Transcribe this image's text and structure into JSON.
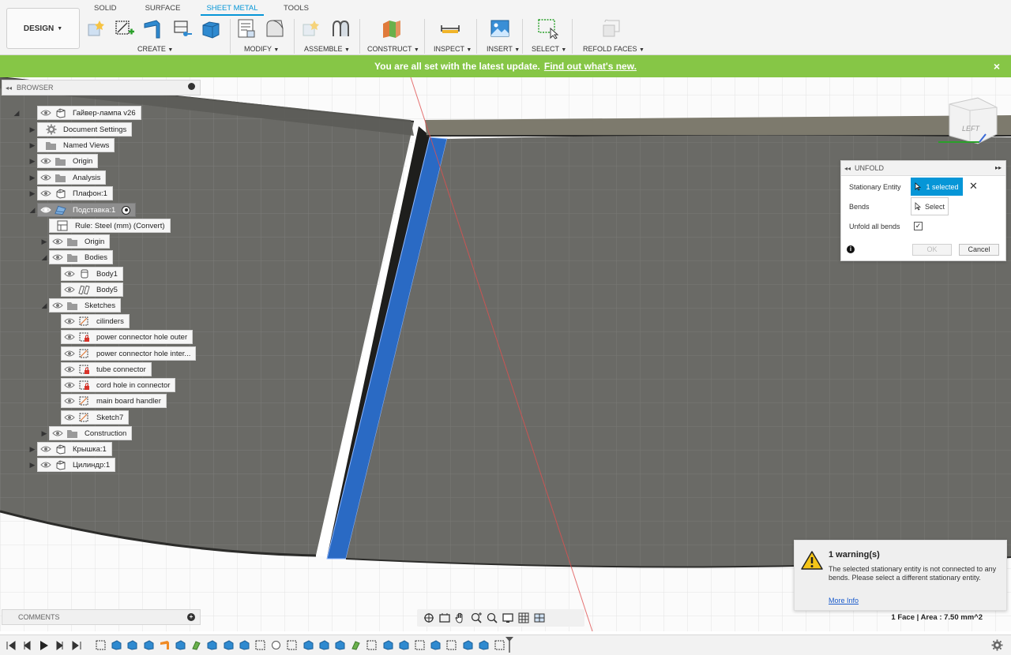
{
  "app": {
    "workspace_button": "DESIGN",
    "workspace_tabs": [
      "SOLID",
      "SURFACE",
      "SHEET METAL",
      "TOOLS"
    ],
    "active_tab": "SHEET METAL",
    "accent_color": "#0696d7"
  },
  "toolbar": {
    "groups": [
      {
        "label": "CREATE",
        "icons": [
          "new-component-icon",
          "create-sketch-icon",
          "flange-icon",
          "sheet-metal-rules-icon",
          "extrude-icon"
        ]
      },
      {
        "label": "MODIFY",
        "icons": [
          "modify-rules-icon",
          "unfold-icon"
        ]
      },
      {
        "label": "ASSEMBLE",
        "icons": [
          "new-component-icon",
          "joint-icon"
        ]
      },
      {
        "label": "CONSTRUCT",
        "icons": [
          "offset-plane-icon"
        ]
      },
      {
        "label": "INSPECT",
        "icons": [
          "measure-icon"
        ]
      },
      {
        "label": "INSERT",
        "icons": [
          "insert-image-icon"
        ]
      },
      {
        "label": "SELECT",
        "icons": [
          "window-select-icon"
        ]
      },
      {
        "label": "REFOLD FACES",
        "icons": [
          "refold-faces-icon"
        ]
      }
    ]
  },
  "notice": {
    "text": "You are all set with the latest update.",
    "link": "Find out what's new.",
    "close": "×",
    "color": "#86c646"
  },
  "browser": {
    "title": "BROWSER",
    "items": [
      {
        "label": "Гайвер-лампа v26",
        "icon": "component-icon",
        "eye": true,
        "expander": "open"
      },
      {
        "label": "Document Settings",
        "icon": "gear-icon",
        "eye": false,
        "expander": "closed"
      },
      {
        "label": "Named Views",
        "icon": "folder-icon",
        "eye": false,
        "expander": "closed"
      },
      {
        "label": "Origin",
        "icon": "folder-icon",
        "eye": true,
        "expander": "closed"
      },
      {
        "label": "Analysis",
        "icon": "folder-icon",
        "eye": true,
        "expander": "closed"
      },
      {
        "label": "Плафон:1",
        "icon": "component-icon",
        "eye": true,
        "expander": "closed"
      },
      {
        "label": "Подставка:1",
        "icon": "sheet-metal-component-icon",
        "eye": true,
        "expander": "open",
        "selected": true,
        "active_target": true
      },
      {
        "label": "Rule: Steel (mm) (Convert)",
        "icon": "sheet-metal-rule-icon",
        "eye": false,
        "expander": "none"
      },
      {
        "label": "Origin",
        "icon": "folder-icon",
        "eye": true,
        "expander": "closed"
      },
      {
        "label": "Bodies",
        "icon": "folder-icon",
        "eye": true,
        "expander": "open"
      },
      {
        "label": "Body1",
        "icon": "body-icon",
        "eye": true,
        "expander": "none"
      },
      {
        "label": "Body5",
        "icon": "sheet-body-icon",
        "eye": true,
        "expander": "none"
      },
      {
        "label": "Sketches",
        "icon": "folder-icon",
        "eye": true,
        "expander": "open"
      },
      {
        "label": "cilinders",
        "icon": "sketch-icon",
        "eye": true,
        "expander": "none"
      },
      {
        "label": "power connector hole outer",
        "icon": "sketch-locked-icon",
        "eye": true,
        "expander": "none"
      },
      {
        "label": "power connector hole inter...",
        "icon": "sketch-icon",
        "eye": true,
        "expander": "none"
      },
      {
        "label": "tube connector",
        "icon": "sketch-locked-icon",
        "eye": true,
        "expander": "none"
      },
      {
        "label": "cord hole in connector",
        "icon": "sketch-locked-icon",
        "eye": true,
        "expander": "none"
      },
      {
        "label": "main board handler",
        "icon": "sketch-icon",
        "eye": true,
        "expander": "none"
      },
      {
        "label": "Sketch7",
        "icon": "sketch-icon",
        "eye": true,
        "expander": "none"
      },
      {
        "label": "Construction",
        "icon": "folder-icon",
        "eye": true,
        "expander": "closed"
      },
      {
        "label": "Крышка:1",
        "icon": "component-icon",
        "eye": true,
        "expander": "closed"
      },
      {
        "label": "Цилиндр:1",
        "icon": "component-icon",
        "eye": true,
        "expander": "closed"
      }
    ]
  },
  "unfold": {
    "title": "UNFOLD",
    "stationary_label": "Stationary Entity",
    "stationary_value": "1 selected",
    "bends_label": "Bends",
    "bends_value": "Select",
    "unfold_all_label": "Unfold all bends",
    "unfold_all_checked": true,
    "ok": "OK",
    "cancel": "Cancel"
  },
  "viewcube": {
    "face": "LEFT"
  },
  "warning": {
    "title": "1 warning(s)",
    "text": "The selected stationary entity is not connected to any bends. Please select a different stationary entity.",
    "link": "More Info"
  },
  "comments": {
    "title": "COMMENTS"
  },
  "status": {
    "selection": "1 Face | Area : 7.50 mm^2"
  },
  "navbar": {
    "icons": [
      "orbit-icon",
      "look-at-icon",
      "pan-icon",
      "zoom-icon",
      "zoom-window-icon",
      "display-settings-icon",
      "grid-icon",
      "viewports-icon"
    ]
  },
  "timeline": {
    "controls": [
      "first-icon",
      "previous-icon",
      "play-icon",
      "next-icon",
      "last-icon"
    ],
    "feature_count": 26
  }
}
